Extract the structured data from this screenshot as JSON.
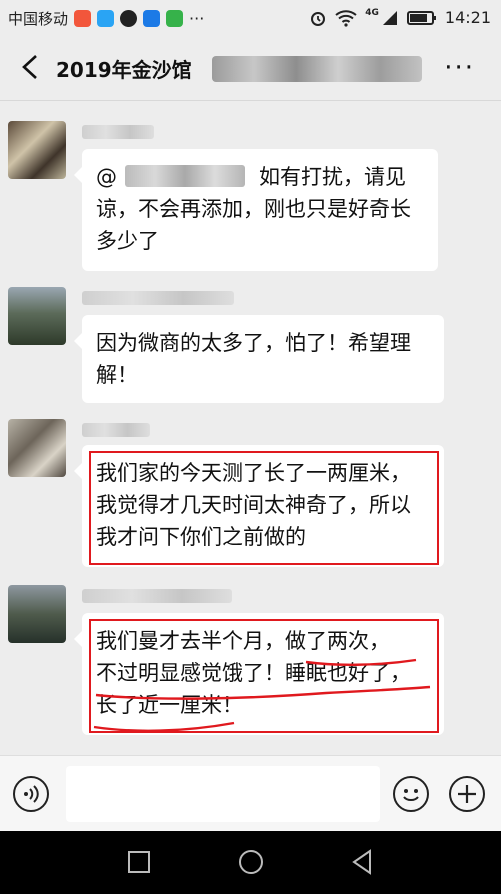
{
  "status_bar": {
    "carrier": "中国移动",
    "network": "4G",
    "time": "14:21",
    "icons": [
      "music-app-icon",
      "health-app-icon",
      "qq-icon",
      "alipay-icon",
      "wechat-dots-icon",
      "more-notifications-icon",
      "alarm-icon",
      "wifi-icon",
      "signal-icon",
      "battery-icon"
    ]
  },
  "header": {
    "title": "2019年金沙馆",
    "back_icon": "chevron-left-icon",
    "more_label": "···"
  },
  "messages": [
    {
      "text_before": "@",
      "text_after": "如有打扰，请见谅，不会再添加，刚也只是好奇长多少了"
    },
    {
      "text": "因为微商的太多了，怕了！希望理解！"
    },
    {
      "text": "我们家的今天测了长了一两厘米，我觉得才几天时间太神奇了，所以我才问下你们之前做的"
    },
    {
      "line1_a": "我们曼才去半个月，",
      "line1_b": "做了两次，",
      "line2": "不过明显感觉饿了！睡眠也好了，",
      "line3": "长了近一厘米！"
    }
  ],
  "input_bar": {
    "placeholder": "",
    "icons": [
      "voice-icon",
      "emoji-icon",
      "plus-icon"
    ]
  },
  "system_nav": {
    "icons": [
      "recent-apps-icon",
      "home-icon",
      "back-icon"
    ]
  },
  "colors": {
    "highlight_red": "#e0191e",
    "background": "#ededed",
    "bubble": "#ffffff"
  }
}
